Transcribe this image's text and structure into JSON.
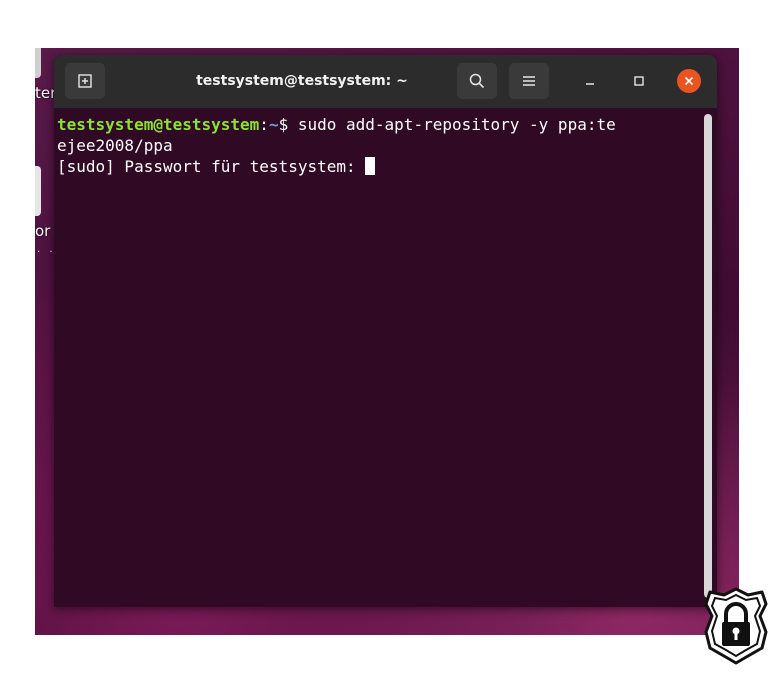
{
  "desktop": {
    "labels": [
      "ter",
      "or"
    ]
  },
  "window": {
    "title": "testsystem@testsystem: ~",
    "icons": {
      "new_tab": "new-tab-icon",
      "search": "search-icon",
      "menu": "hamburger-menu-icon",
      "minimize": "minimize-icon",
      "maximize": "maximize-icon",
      "close": "close-icon"
    },
    "colors": {
      "titlebar": "#2c2c2c",
      "terminal_bg": "#300a24",
      "close_button": "#e95420",
      "prompt_user": "#8ae234",
      "prompt_path": "#729fcf"
    }
  },
  "terminal": {
    "prompt_user_host": "testsystem@testsystem",
    "prompt_colon": ":",
    "prompt_path": "~",
    "prompt_symbol": "$ ",
    "command_line1": "sudo add-apt-repository -y ppa:te",
    "command_line2": "ejee2008/ppa",
    "sudo_prompt": "[sudo] Passwort für testsystem: "
  },
  "badge": {
    "icon": "padlock-shield-icon"
  }
}
